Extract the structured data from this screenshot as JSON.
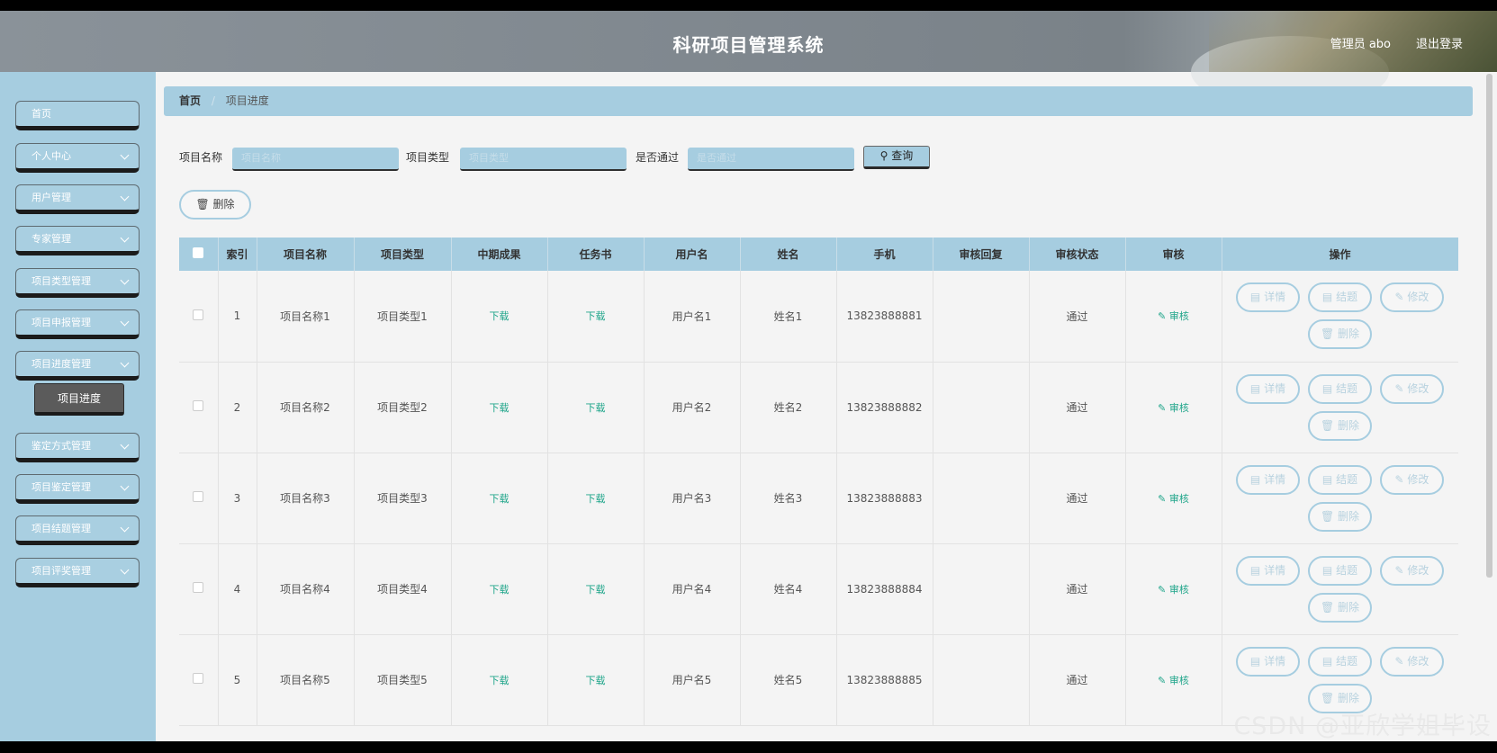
{
  "header": {
    "title": "科研项目管理系统",
    "admin_label": "管理员 abo",
    "logout_label": "退出登录"
  },
  "sidebar": {
    "items": [
      {
        "label": "首页"
      },
      {
        "label": "个人中心"
      },
      {
        "label": "用户管理"
      },
      {
        "label": "专家管理"
      },
      {
        "label": "项目类型管理"
      },
      {
        "label": "项目申报管理"
      },
      {
        "label": "项目进度管理"
      },
      {
        "label": "鉴定方式管理"
      },
      {
        "label": "项目鉴定管理"
      },
      {
        "label": "项目结题管理"
      },
      {
        "label": "项目评奖管理"
      }
    ],
    "active_subitem": "项目进度"
  },
  "breadcrumb": {
    "home": "首页",
    "separator": "/",
    "current": "项目进度"
  },
  "search": {
    "name_label": "项目名称",
    "name_placeholder": "项目名称",
    "type_label": "项目类型",
    "type_placeholder": "项目类型",
    "pass_label": "是否通过",
    "pass_placeholder": "是否通过",
    "query_label": "查询"
  },
  "actions": {
    "delete_label": "删除"
  },
  "table": {
    "headers": [
      "索引",
      "项目名称",
      "项目类型",
      "中期成果",
      "任务书",
      "用户名",
      "姓名",
      "手机",
      "审核回复",
      "审核状态",
      "审核",
      "操作"
    ],
    "download_label": "下载",
    "audit_label": "审核",
    "op_labels": {
      "detail": "详情",
      "finish": "结题",
      "edit": "修改",
      "delete": "删除"
    },
    "rows": [
      {
        "index": "1",
        "name": "项目名称1",
        "type": "项目类型1",
        "username": "用户名1",
        "realname": "姓名1",
        "phone": "13823888881",
        "reply": "",
        "status": "通过"
      },
      {
        "index": "2",
        "name": "项目名称2",
        "type": "项目类型2",
        "username": "用户名2",
        "realname": "姓名2",
        "phone": "13823888882",
        "reply": "",
        "status": "通过"
      },
      {
        "index": "3",
        "name": "项目名称3",
        "type": "项目类型3",
        "username": "用户名3",
        "realname": "姓名3",
        "phone": "13823888883",
        "reply": "",
        "status": "通过"
      },
      {
        "index": "4",
        "name": "项目名称4",
        "type": "项目类型4",
        "username": "用户名4",
        "realname": "姓名4",
        "phone": "13823888884",
        "reply": "",
        "status": "通过"
      },
      {
        "index": "5",
        "name": "项目名称5",
        "type": "项目类型5",
        "username": "用户名5",
        "realname": "姓名5",
        "phone": "13823888885",
        "reply": "",
        "status": "通过"
      }
    ]
  },
  "watermark": "CSDN @亚欣学姐毕设",
  "colors": {
    "accent": "#a6cde0",
    "link": "#1fa58a"
  }
}
